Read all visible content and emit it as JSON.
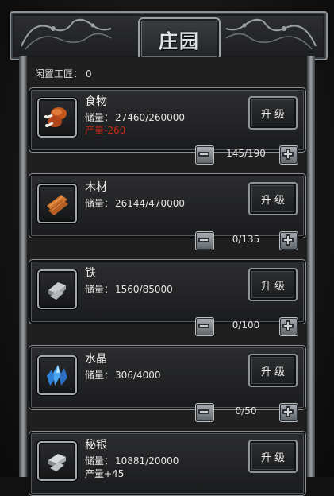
{
  "title": "庄园",
  "idle": {
    "label": "闲置工匠：",
    "value": "0"
  },
  "storage_label": "储量：",
  "resources": [
    {
      "name": "食物",
      "storage": "27460/260000",
      "production": "产量-260",
      "production_color": "#c62a16",
      "workers": "145/190",
      "upgrade_label": "升级",
      "icon": "meat-icon"
    },
    {
      "name": "木材",
      "storage": "26144/470000",
      "production": "",
      "production_color": "#e0e0e0",
      "workers": "0/135",
      "upgrade_label": "升级",
      "icon": "wood-planks-icon"
    },
    {
      "name": "铁",
      "storage": "1560/85000",
      "production": "",
      "production_color": "#e0e0e0",
      "workers": "0/100",
      "upgrade_label": "升级",
      "icon": "iron-ingot-icon"
    },
    {
      "name": "水晶",
      "storage": "306/4000",
      "production": "",
      "production_color": "#e0e0e0",
      "workers": "0/50",
      "upgrade_label": "升级",
      "icon": "crystal-icon"
    },
    {
      "name": "秘银",
      "storage": "10881/20000",
      "production": "产量+45",
      "production_color": "#e6e6e6",
      "workers": "",
      "upgrade_label": "升级",
      "icon": "mithril-ingot-icon"
    }
  ]
}
